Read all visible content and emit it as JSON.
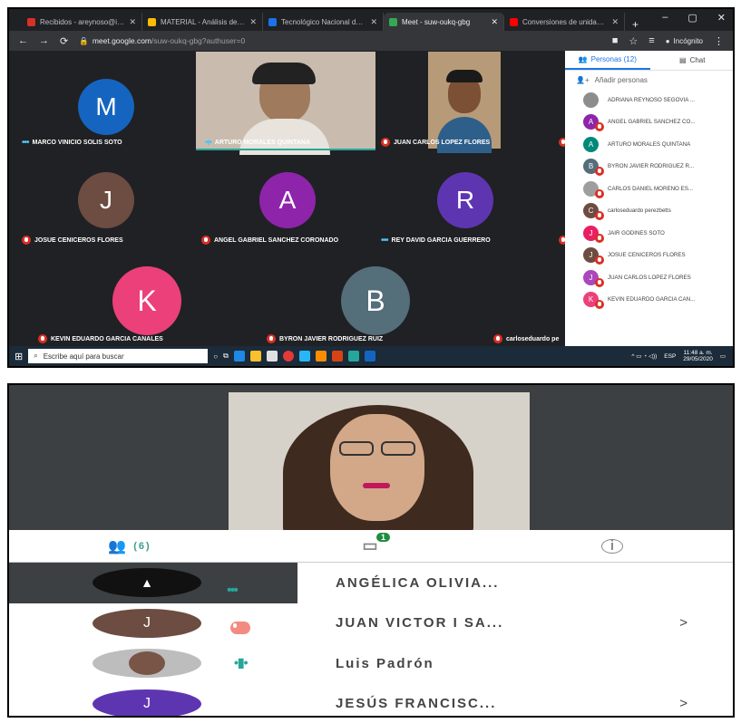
{
  "browser": {
    "tabs": [
      {
        "label": "Recibidos - areynoso@itslerdo.",
        "color": "#d93025",
        "active": false
      },
      {
        "label": "MATERIAL - Análisis de circuitos",
        "color": "#fbbc04",
        "active": false
      },
      {
        "label": "Tecnológico Nacional de Méxi",
        "color": "#1a73e8",
        "active": false
      },
      {
        "label": "Meet - suw-oukq-gbg",
        "color": "#34a853",
        "active": true
      },
      {
        "label": "Conversiones de unidades (Fu",
        "color": "#ff0000",
        "active": false
      }
    ],
    "new_tab": "+",
    "controls": [
      "–",
      "▢",
      "✕"
    ],
    "url_domain": "meet.google.com",
    "url_path": "/suw-oukq-gbg?authuser=0",
    "incognito_label": "Incógnito"
  },
  "grid": [
    {
      "name": "MARCO VINICIO SOLIS SOTO",
      "initial": "M",
      "color": "#1565c0",
      "status": "dots"
    },
    {
      "name": "ARTURO MORALES QUINTANA",
      "initial": "",
      "color": "",
      "status": "speaking"
    },
    {
      "name": "JUAN CARLOS LOPEZ FLORES",
      "initial": "",
      "color": "",
      "status": "muted"
    },
    {
      "name": "JOSUE CENICEROS FLORES",
      "initial": "J",
      "color": "#6d4c41",
      "status": "muted"
    },
    {
      "name": "ANGEL GABRIEL SANCHEZ CORONADO",
      "initial": "A",
      "color": "#8e24aa",
      "status": "muted"
    },
    {
      "name": "REY DAVID GARCIA GUERRERO",
      "initial": "R",
      "color": "#5e35b1",
      "status": "dots"
    },
    {
      "name": "KEVIN EDUARDO GARCIA CANALES",
      "initial": "K",
      "color": "#ec407a",
      "status": "muted"
    },
    {
      "name": "BYRON JAVIER RODRIGUEZ RUIZ",
      "initial": "B",
      "color": "#546e7a",
      "status": "muted"
    },
    {
      "name": "carloseduardo pe",
      "initial": "",
      "color": "",
      "status": "muted"
    }
  ],
  "side_panel": {
    "people_tab": "Personas (12)",
    "chat_tab": "Chat",
    "add_people": "Añadir personas",
    "people": [
      {
        "name": "ADRIANA REYNOSO SEGOVIA ...",
        "initial": "",
        "color": "#8d8d8d"
      },
      {
        "name": "ANGEL GABRIEL SANCHEZ CO...",
        "initial": "A",
        "color": "#8e24aa"
      },
      {
        "name": "ARTURO MORALES QUINTANA",
        "initial": "A",
        "color": "#00897b"
      },
      {
        "name": "BYRON JAVIER RODRIGUEZ R...",
        "initial": "B",
        "color": "#546e7a"
      },
      {
        "name": "CARLOS DANIEL MORENO ES...",
        "initial": "",
        "color": "#9e9e9e"
      },
      {
        "name": "carloseduardo perezbetts",
        "initial": "C",
        "color": "#6d4c41"
      },
      {
        "name": "JAIR GODINES SOTO",
        "initial": "J",
        "color": "#e91e63"
      },
      {
        "name": "JOSUE CENICEROS FLORES",
        "initial": "J",
        "color": "#6d4c41"
      },
      {
        "name": "JUAN CARLOS LOPEZ FLORES",
        "initial": "J",
        "color": "#ab47bc"
      },
      {
        "name": "KEVIN EDUARDO GARCIA CAN...",
        "initial": "K",
        "color": "#ec407a"
      }
    ]
  },
  "taskbar": {
    "search_placeholder": "Escribe aquí para buscar",
    "lang": "ESP",
    "time": "11:48 a. m.",
    "date": "29/05/2020"
  },
  "mobile": {
    "people_count": "(6)",
    "chat_badge": "1",
    "people": [
      {
        "name": "ANGÉLICA OLIVIA...",
        "initial": "",
        "color": "#111"
      },
      {
        "name": "JUAN VICTOR I SA...",
        "initial": "J",
        "color": "#6d4c41"
      },
      {
        "name": "Luis Padrón",
        "initial": "",
        "color": "#9e9e9e"
      },
      {
        "name": "JESÚS FRANCISC...",
        "initial": "J",
        "color": "#5e35b1"
      }
    ],
    "chevron": ">"
  }
}
